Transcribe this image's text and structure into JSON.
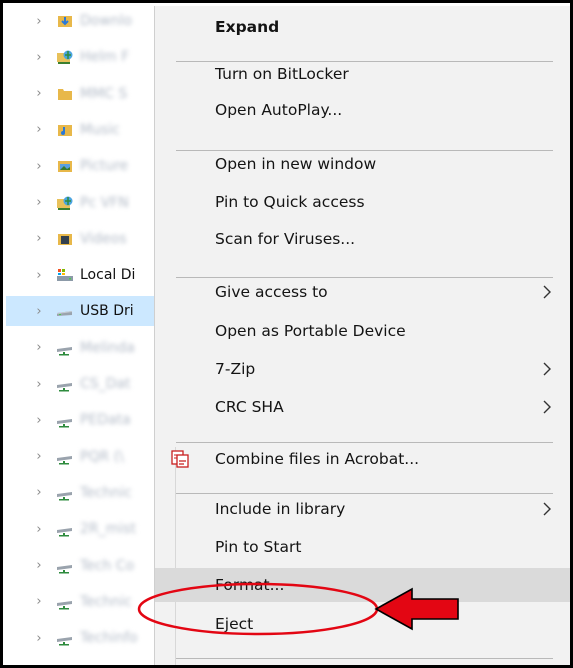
{
  "tree": {
    "items": [
      {
        "label": "Downlo",
        "icon": "downloads-folder-icon",
        "blurred": true,
        "selected": false
      },
      {
        "label": "Helm F",
        "icon": "network-folder-icon",
        "blurred": true,
        "selected": false
      },
      {
        "label": "MMC S",
        "icon": "folder-icon",
        "blurred": true,
        "selected": false
      },
      {
        "label": "Music",
        "icon": "music-folder-icon",
        "blurred": true,
        "selected": false
      },
      {
        "label": "Picture",
        "icon": "pictures-folder-icon",
        "blurred": true,
        "selected": false
      },
      {
        "label": "Pc VFN",
        "icon": "network-folder-icon",
        "blurred": true,
        "selected": false
      },
      {
        "label": "Videos",
        "icon": "videos-folder-icon",
        "blurred": true,
        "selected": false
      },
      {
        "label": "Local Di",
        "icon": "local-disk-icon",
        "blurred": false,
        "selected": false
      },
      {
        "label": "USB Dri",
        "icon": "usb-drive-icon",
        "blurred": false,
        "selected": true
      },
      {
        "label": "Melinda",
        "icon": "network-drive-icon",
        "blurred": true,
        "selected": false
      },
      {
        "label": "CS_Dat",
        "icon": "network-drive-icon",
        "blurred": true,
        "selected": false
      },
      {
        "label": "PEData",
        "icon": "network-drive-icon",
        "blurred": true,
        "selected": false
      },
      {
        "label": "PQR (\\",
        "icon": "network-drive-icon",
        "blurred": true,
        "selected": false
      },
      {
        "label": "Technic",
        "icon": "network-drive-icon",
        "blurred": true,
        "selected": false
      },
      {
        "label": "2R_mist",
        "icon": "network-drive-icon",
        "blurred": true,
        "selected": false
      },
      {
        "label": "Tech Co",
        "icon": "network-drive-icon",
        "blurred": true,
        "selected": false
      },
      {
        "label": "Technic",
        "icon": "network-drive-icon",
        "blurred": true,
        "selected": false
      },
      {
        "label": "Techinfo",
        "icon": "network-drive-icon",
        "blurred": true,
        "selected": false
      }
    ]
  },
  "menu": {
    "items": [
      {
        "label": "Expand",
        "bold": true
      },
      {
        "label": "Turn on BitLocker"
      },
      {
        "label": "Open AutoPlay..."
      },
      {
        "label": "Open in new window"
      },
      {
        "label": "Pin to Quick access"
      },
      {
        "label": "Scan for Viruses..."
      },
      {
        "label": "Give access to",
        "submenu": true
      },
      {
        "label": "Open as Portable Device"
      },
      {
        "label": "7-Zip",
        "submenu": true
      },
      {
        "label": "CRC SHA",
        "submenu": true
      },
      {
        "label": "Combine files in Acrobat...",
        "icon": "acrobat-combine-icon"
      },
      {
        "label": "Include in library",
        "submenu": true
      },
      {
        "label": "Pin to Start"
      },
      {
        "label": "Format...",
        "highlighted": true
      },
      {
        "label": "Eject"
      }
    ]
  },
  "annotation": {
    "circle_color": "#e30613",
    "arrow_color": "#e30613",
    "target": "Format..."
  },
  "colors": {
    "menu_bg": "#f2f2f2",
    "hover": "#dadada",
    "selection": "#cce8ff",
    "separator": "#b9b9b9"
  }
}
